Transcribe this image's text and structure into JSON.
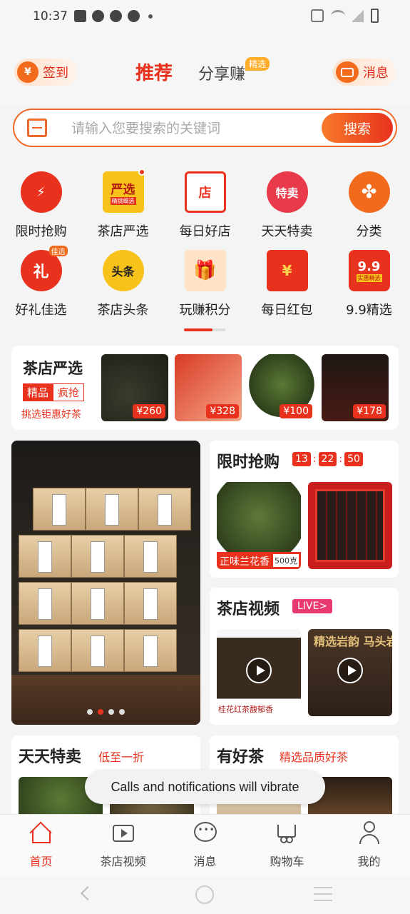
{
  "status_bar": {
    "time": "10:37"
  },
  "header": {
    "checkin_label": "签到",
    "checkin_icon": "yen-icon",
    "tab_recommend": "推荐",
    "tab_share": "分享赚",
    "tab_share_badge": "精选",
    "message_label": "消息"
  },
  "search": {
    "placeholder": "请输入您要搜索的关键词",
    "button": "搜索"
  },
  "categories": [
    {
      "label": "限时抢购",
      "icon_text": "⚡",
      "color": "#e8321e"
    },
    {
      "label": "茶店严选",
      "icon_text": "严选",
      "icon_sub": "精挑细选",
      "color": "#f7c21a"
    },
    {
      "label": "每日好店",
      "icon_text": "店",
      "color": "#e8321e"
    },
    {
      "label": "天天特卖",
      "icon_text": "特卖",
      "color": "#e83a4a"
    },
    {
      "label": "分类",
      "icon_text": "✤",
      "color": "#f26b1d"
    },
    {
      "label": "好礼佳选",
      "icon_text": "礼",
      "icon_badge": "佳选",
      "color": "#e8321e"
    },
    {
      "label": "茶店头条",
      "icon_text": "头条",
      "color": "#f7c21a"
    },
    {
      "label": "玩赚积分",
      "icon_text": "🎁",
      "color": "#f26b1d"
    },
    {
      "label": "每日红包",
      "icon_text": "¥",
      "color": "#e8321e"
    },
    {
      "label": "9.9精选",
      "icon_text": "9.9",
      "icon_sub": "实惠精选",
      "color": "#e8321e"
    }
  ],
  "selection": {
    "title": "茶店严选",
    "tag1": "精品",
    "tag2": "疯抢",
    "subtitle": "挑选钜惠好茶",
    "products": [
      {
        "price": "¥260"
      },
      {
        "price": "¥328"
      },
      {
        "price": "¥100"
      },
      {
        "price": "¥178"
      }
    ]
  },
  "flash_sale": {
    "title": "限时抢购",
    "hours": "13",
    "minutes": "22",
    "seconds": "50",
    "product1_caption": "正味兰花香",
    "product1_weight": "500克"
  },
  "video": {
    "title": "茶店视频",
    "live_badge": "LIVE>",
    "video1_caption": "桂花红茶馥郁香",
    "video2_caption": "精选岩韵 马头岩肉桂"
  },
  "bottom_cards": {
    "left_title": "天天特卖",
    "left_subtitle": "低至一折",
    "right_title": "有好茶",
    "right_subtitle": "精选品质好茶"
  },
  "toast": "Calls and notifications will vibrate",
  "tabbar": [
    {
      "label": "首页",
      "active": true
    },
    {
      "label": "茶店视频"
    },
    {
      "label": "消息"
    },
    {
      "label": "购物车"
    },
    {
      "label": "我的"
    }
  ]
}
